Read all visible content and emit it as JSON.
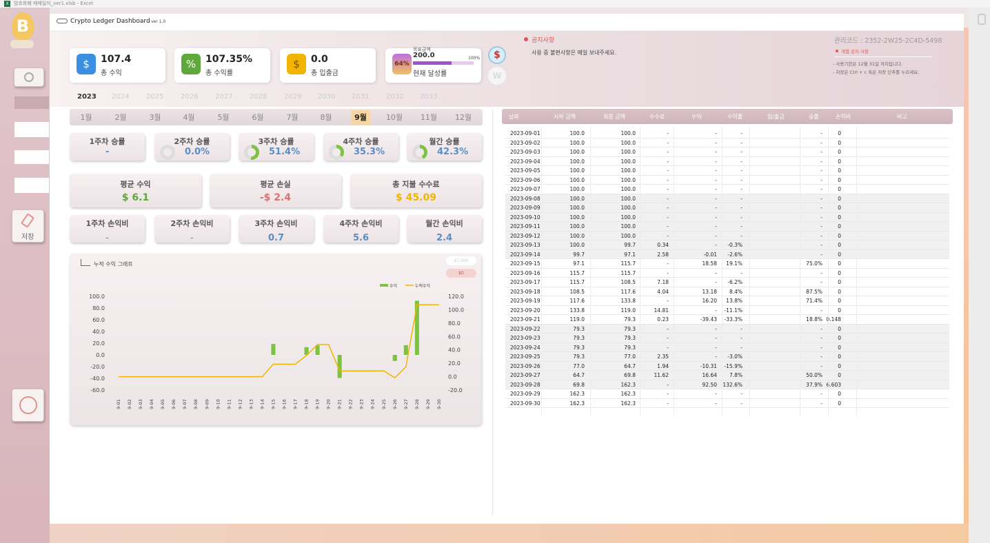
{
  "window": {
    "title": "암호화폐 매매일지_ver1.xlsb - Excel",
    "excel_icon": "X"
  },
  "app": {
    "title": "Crypto Ledger Dashboard",
    "version": "- ver 1.0"
  },
  "sidebar": {
    "save_label": "저장"
  },
  "kpis": [
    {
      "value": "107.4",
      "label": "총 수익",
      "icon": "$",
      "color": "#3b8fe0"
    },
    {
      "value": "107.35%",
      "label": "총 수익률",
      "icon": "%",
      "color": "#5ea83c"
    },
    {
      "value": "0.0",
      "label": "총 입출금",
      "icon": "$",
      "color": "#f1b400"
    }
  ],
  "goal": {
    "caption": "목표금액",
    "value": "200.0",
    "pct": "64%",
    "max": "100%",
    "label": "현재 달성률",
    "fill_fraction": 0.64
  },
  "currency": {
    "usd": "$",
    "krw": "W"
  },
  "notice": {
    "title": "공지사항",
    "text": "사용 중 불편사항은 메일 보내주세요.",
    "code": "관리코드 : 2352-2W25-2C4D-5498",
    "sub": "개별 공지 사항",
    "lines": [
      "- 사용기한은 12월 31일 까지입니다.",
      "- 저장은 Ctrl + c 혹은 저장 단추를 누르세요."
    ]
  },
  "years": [
    "2023",
    "2024",
    "2025",
    "2026",
    "2027",
    "2028",
    "2029",
    "2030",
    "2031",
    "2032",
    "2033"
  ],
  "months": [
    "1월",
    "2월",
    "3월",
    "4월",
    "5월",
    "6월",
    "7월",
    "8월",
    "9월",
    "10월",
    "11월",
    "12월"
  ],
  "selected_month": "9월",
  "win_rates": [
    {
      "label": "1주차 승률",
      "value": "-",
      "pct": 0
    },
    {
      "label": "2주차 승률",
      "value": "0.0%",
      "pct": 0
    },
    {
      "label": "3주차 승률",
      "value": "51.4%",
      "pct": 51.4
    },
    {
      "label": "4주차 승률",
      "value": "35.3%",
      "pct": 35.3
    },
    {
      "label": "월간 승률",
      "value": "42.3%",
      "pct": 42.3
    }
  ],
  "stats": [
    {
      "label": "평균 수익",
      "value": "$ 6.1",
      "color": "#5ea83c"
    },
    {
      "label": "평균 손실",
      "value": "-$ 2.4",
      "color": "#e07070"
    },
    {
      "label": "총 지불 수수료",
      "value": "$ 45.09",
      "color": "#f1b400"
    }
  ],
  "pl_ratios": [
    {
      "label": "1주차 손익비",
      "value": "-"
    },
    {
      "label": "2주차 손익비",
      "value": "-"
    },
    {
      "label": "3주차 손익비",
      "value": "0.7"
    },
    {
      "label": "4주차 손익비",
      "value": "5.6"
    },
    {
      "label": "월간 손익비",
      "value": "2.4"
    }
  ],
  "chart_panel": {
    "title": "누적 수익 그래프",
    "btn1": "$7,000",
    "btn2": "$0"
  },
  "chart_data": {
    "type": "bar+line",
    "title": "누적 수익 그래프",
    "categories": [
      "9-01",
      "9-02",
      "9-03",
      "9-04",
      "9-05",
      "9-06",
      "9-07",
      "9-08",
      "9-09",
      "9-10",
      "9-11",
      "9-12",
      "9-13",
      "9-14",
      "9-15",
      "9-16",
      "9-17",
      "9-18",
      "9-19",
      "9-20",
      "9-21",
      "9-22",
      "9-23",
      "9-24",
      "9-25",
      "9-26",
      "9-27",
      "9-28",
      "9-29",
      "9-30"
    ],
    "series": [
      {
        "name": "수익",
        "type": "bar",
        "axis": "left",
        "color": "#7dc242",
        "values": [
          0,
          0,
          0,
          0,
          0,
          0,
          0,
          0,
          0,
          0,
          0,
          0,
          0,
          0,
          18.58,
          0,
          0,
          13.18,
          16.2,
          0,
          -39.43,
          0,
          0,
          0,
          0,
          -10.31,
          16.64,
          92.5,
          0,
          0
        ]
      },
      {
        "name": "누적수익",
        "type": "line",
        "axis": "right",
        "color": "#f1b400",
        "values": [
          0,
          0,
          0,
          0,
          0,
          0,
          0,
          0,
          0,
          0,
          0,
          0,
          0,
          0,
          18.58,
          18.58,
          18.58,
          31.76,
          47.96,
          47.96,
          8.53,
          8.53,
          8.53,
          8.53,
          8.53,
          -1.78,
          14.86,
          107.36,
          107.36,
          107.36
        ]
      }
    ],
    "y_left": {
      "min": -60,
      "max": 100,
      "ticks": [
        "100.0",
        "80.0",
        "60.0",
        "40.0",
        "20.0",
        "0.0",
        "-20.0",
        "-40.0",
        "-60.0"
      ]
    },
    "y_right": {
      "min": -20,
      "max": 120,
      "ticks": [
        "120.0",
        "100.0",
        "80.0",
        "60.0",
        "40.0",
        "20.0",
        "0.0",
        "-20.0"
      ]
    }
  },
  "table": {
    "headers": [
      "날짜",
      "시작 금액",
      "최종 금액",
      "수수료",
      "수익",
      "수익률",
      "입/출금",
      "승률",
      "손익비",
      "비고"
    ],
    "rows": [
      [
        "2023-09-01",
        "100.0",
        "100.0",
        "-",
        "-",
        "-",
        "",
        "-",
        "0"
      ],
      [
        "2023-09-02",
        "100.0",
        "100.0",
        "-",
        "-",
        "-",
        "",
        "-",
        "0"
      ],
      [
        "2023-09-03",
        "100.0",
        "100.0",
        "-",
        "-",
        "-",
        "",
        "-",
        "0"
      ],
      [
        "2023-09-04",
        "100.0",
        "100.0",
        "-",
        "-",
        "-",
        "",
        "-",
        "0"
      ],
      [
        "2023-09-05",
        "100.0",
        "100.0",
        "-",
        "-",
        "-",
        "",
        "-",
        "0"
      ],
      [
        "2023-09-06",
        "100.0",
        "100.0",
        "-",
        "-",
        "-",
        "",
        "-",
        "0"
      ],
      [
        "2023-09-07",
        "100.0",
        "100.0",
        "-",
        "-",
        "-",
        "",
        "-",
        "0"
      ],
      [
        "2023-09-08",
        "100.0",
        "100.0",
        "-",
        "-",
        "-",
        "",
        "-",
        "0"
      ],
      [
        "2023-09-09",
        "100.0",
        "100.0",
        "-",
        "-",
        "-",
        "",
        "-",
        "0"
      ],
      [
        "2023-09-10",
        "100.0",
        "100.0",
        "-",
        "-",
        "-",
        "",
        "-",
        "0"
      ],
      [
        "2023-09-11",
        "100.0",
        "100.0",
        "-",
        "-",
        "-",
        "",
        "-",
        "0"
      ],
      [
        "2023-09-12",
        "100.0",
        "100.0",
        "-",
        "-",
        "-",
        "",
        "-",
        "0"
      ],
      [
        "2023-09-13",
        "100.0",
        "99.7",
        "0.34",
        "-",
        "-0.3%",
        "",
        "-",
        "0"
      ],
      [
        "2023-09-14",
        "99.7",
        "97.1",
        "2.58",
        "-0.01",
        "-2.6%",
        "",
        "-",
        "0"
      ],
      [
        "2023-09-15",
        "97.1",
        "115.7",
        "-",
        "18.58",
        "19.1%",
        "",
        "75.0%",
        "0"
      ],
      [
        "2023-09-16",
        "115.7",
        "115.7",
        "-",
        "-",
        "-",
        "",
        "-",
        "0"
      ],
      [
        "2023-09-17",
        "115.7",
        "108.5",
        "7.18",
        "-",
        "-6.2%",
        "",
        "-",
        "0"
      ],
      [
        "2023-09-18",
        "108.5",
        "117.6",
        "4.04",
        "13.18",
        "8.4%",
        "",
        "87.5%",
        "0"
      ],
      [
        "2023-09-19",
        "117.6",
        "133.8",
        "-",
        "16.20",
        "13.8%",
        "",
        "71.4%",
        "0"
      ],
      [
        "2023-09-20",
        "133.8",
        "119.0",
        "14.81",
        "-",
        "-11.1%",
        "",
        "-",
        "0"
      ],
      [
        "2023-09-21",
        "119.0",
        "79.3",
        "0.23",
        "-39.43",
        "-33.3%",
        "",
        "18.8%",
        "0.148"
      ],
      [
        "2023-09-22",
        "79.3",
        "79.3",
        "-",
        "-",
        "-",
        "",
        "-",
        "0"
      ],
      [
        "2023-09-23",
        "79.3",
        "79.3",
        "-",
        "-",
        "-",
        "",
        "-",
        "0"
      ],
      [
        "2023-09-24",
        "79.3",
        "79.3",
        "-",
        "-",
        "-",
        "",
        "-",
        "0"
      ],
      [
        "2023-09-25",
        "79.3",
        "77.0",
        "2.35",
        "-",
        "-3.0%",
        "",
        "-",
        "0"
      ],
      [
        "2023-09-26",
        "77.0",
        "64.7",
        "1.94",
        "-10.31",
        "-15.9%",
        "",
        "-",
        "0"
      ],
      [
        "2023-09-27",
        "64.7",
        "69.8",
        "11.62",
        "16.64",
        "7.8%",
        "",
        "50.0%",
        "0"
      ],
      [
        "2023-09-28",
        "69.8",
        "162.3",
        "-",
        "92.50",
        "132.6%",
        "",
        "37.9%",
        "6.603"
      ],
      [
        "2023-09-29",
        "162.3",
        "162.3",
        "-",
        "-",
        "-",
        "",
        "-",
        "0"
      ],
      [
        "2023-09-30",
        "162.3",
        "162.3",
        "-",
        "-",
        "-",
        "",
        "-",
        "0"
      ]
    ]
  },
  "colors": {
    "accent": "#d4b0b8",
    "blue": "#5b8ec4",
    "green": "#7dc242",
    "gold": "#f1b400",
    "red": "#e07070"
  }
}
